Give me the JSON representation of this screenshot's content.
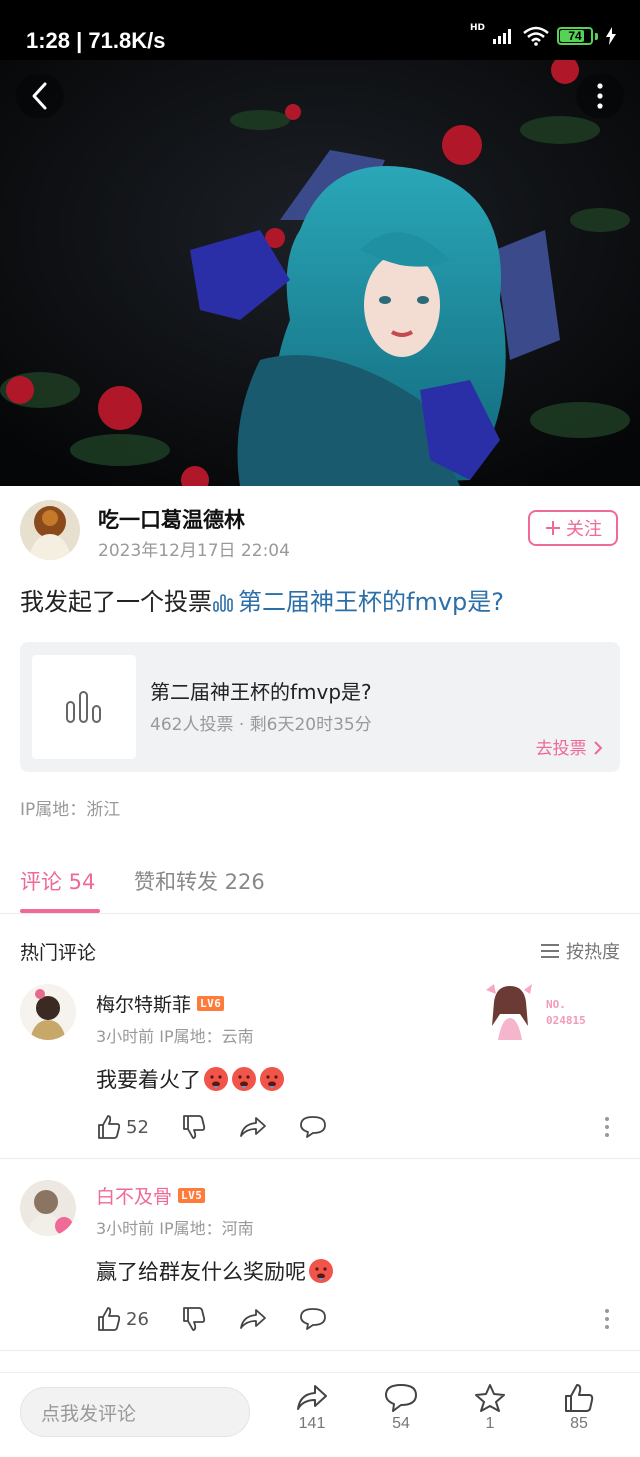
{
  "status_bar": {
    "time": "1:28 | 71.8K/s",
    "hd": "HD",
    "battery": "74"
  },
  "author": {
    "name": "吃一口葛温德林",
    "date": "2023年12月17日 22:04",
    "follow_label": "关注"
  },
  "post": {
    "title_prefix": "我发起了一个投票",
    "vote_link": "第二届神王杯的fmvp是?"
  },
  "vote_card": {
    "title": "第二届神王杯的fmvp是?",
    "meta": "462人投票 · 剩6天20时35分",
    "go_label": "去投票"
  },
  "ip_location": "IP属地：浙江",
  "tabs": {
    "comments": "评论 54",
    "likes_reposts": "赞和转发 226"
  },
  "hot_comments": {
    "title": "热门评论",
    "sort_label": "按热度"
  },
  "comments": [
    {
      "name": "梅尔特斯菲",
      "level": "LV6",
      "meta": "3小时前  IP属地：云南",
      "text": "我要着火了",
      "likes": "52",
      "name_color": "#222222",
      "badge_no": "NO.",
      "badge_num": "024815"
    },
    {
      "name": "白不及骨",
      "level": "LV5",
      "meta": "3小时前  IP属地：河南",
      "text": "赢了给群友什么奖励呢",
      "likes": "26",
      "name_color": "#ef6a96"
    }
  ],
  "bottom_bar": {
    "input_placeholder": "点我发评论",
    "share_count": "141",
    "comment_count": "54",
    "star_count": "1",
    "like_count": "85"
  },
  "colors": {
    "accent": "#ef6a96",
    "link": "#2b6fa8",
    "level_badge": "#ff7b3b"
  },
  "icons": [
    "back-icon",
    "more-icon",
    "plus-icon",
    "bar-chart-icon",
    "chevron-right-icon",
    "sort-icon",
    "thumbs-up-icon",
    "thumbs-down-icon",
    "share-icon",
    "comment-icon",
    "star-icon",
    "kebab-icon"
  ]
}
